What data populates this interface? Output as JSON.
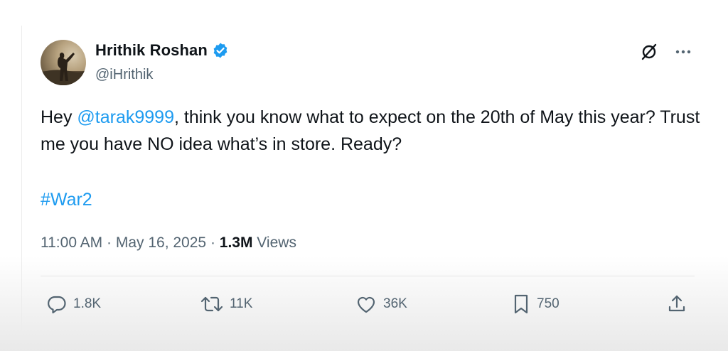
{
  "author": {
    "name": "Hrithik Roshan",
    "handle": "@iHrithik",
    "verified_color": "#1d9bf0"
  },
  "tweet": {
    "text_prefix": "Hey ",
    "mention": "@tarak9999",
    "text_rest": ", think you know what to expect on the 20th of May this year? Trust me you have NO idea what’s in store. Ready?",
    "hashtag": "#War2"
  },
  "meta": {
    "time": "11:00 AM",
    "sep1": " · ",
    "date": "May 16, 2025",
    "sep2": " · ",
    "views_count": "1.3M",
    "views_label": " Views"
  },
  "actions": {
    "replies": "1.8K",
    "reposts": "11K",
    "likes": "36K",
    "bookmarks": "750"
  },
  "icons": {
    "grok": "grok-icon",
    "more": "more-icon",
    "reply": "reply-icon",
    "repost": "repost-icon",
    "like": "heart-icon",
    "bookmark": "bookmark-icon",
    "share": "share-icon"
  },
  "colors": {
    "link": "#1d9bf0",
    "text": "#0f1419",
    "muted": "#536471"
  }
}
